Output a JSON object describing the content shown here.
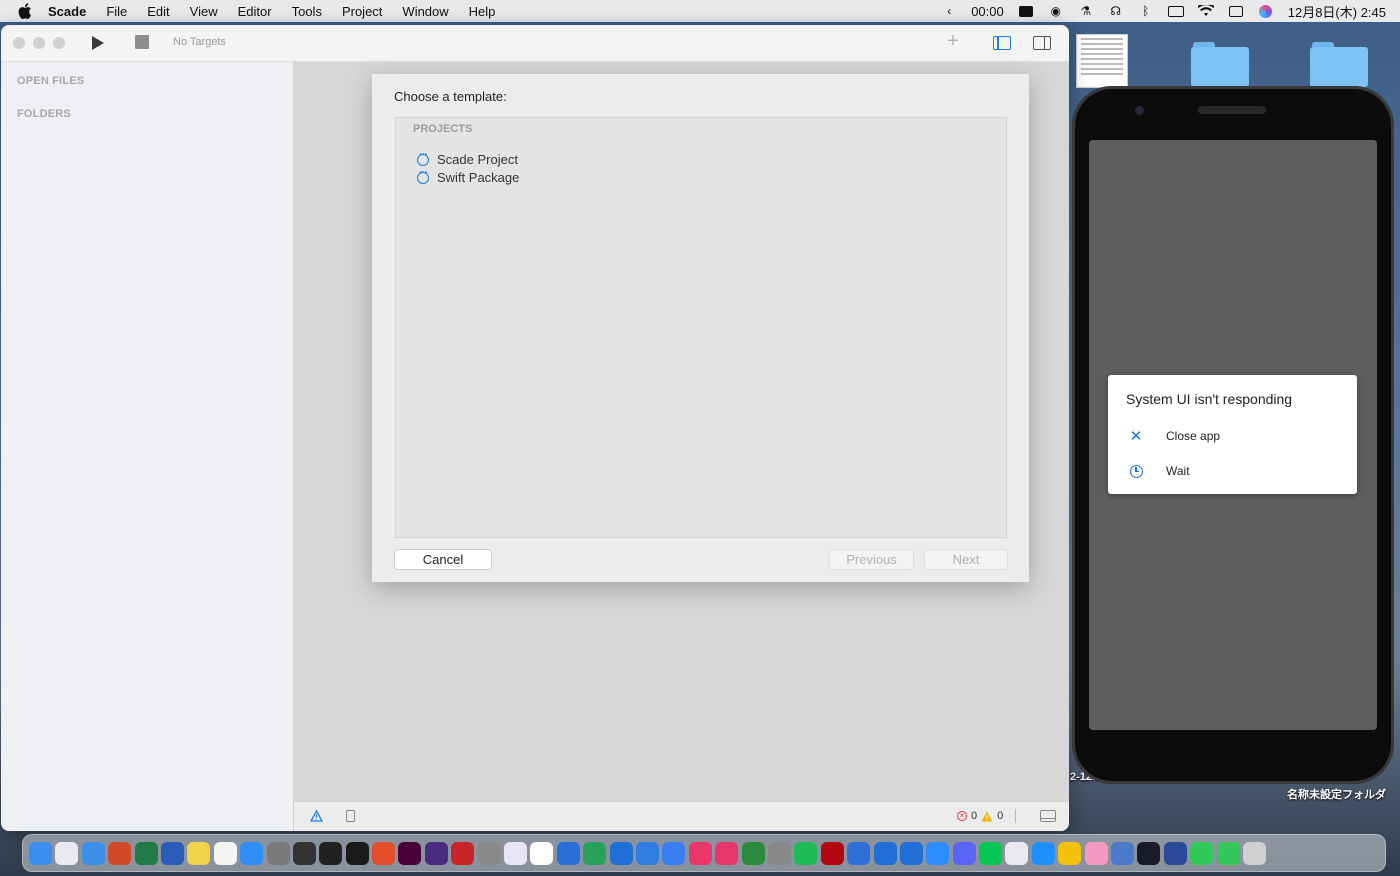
{
  "menubar": {
    "app_name": "Scade",
    "items": [
      "File",
      "Edit",
      "View",
      "Editor",
      "Tools",
      "Project",
      "Window",
      "Help"
    ],
    "time_counter": "00:00",
    "datetime": "12月8日(木) 2:45"
  },
  "desktop": {
    "folder_label": "名称未設定フォルダ",
    "partial_label": "2-12..."
  },
  "window": {
    "targets_label": "No Targets",
    "sidebar": {
      "open_files": "OPEN FILES",
      "folders": "FOLDERS"
    },
    "status": {
      "errors": "0",
      "warnings": "0"
    }
  },
  "dialog": {
    "title": "Choose a template:",
    "section": "PROJECTS",
    "templates": [
      {
        "label": "Scade Project"
      },
      {
        "label": "Swift Package"
      }
    ],
    "cancel": "Cancel",
    "previous": "Previous",
    "next": "Next"
  },
  "phone": {
    "dialog_title": "System UI isn't responding",
    "options": [
      {
        "label": "Close app",
        "icon": "close-icon"
      },
      {
        "label": "Wait",
        "icon": "clock-icon"
      }
    ]
  },
  "dock": {
    "colors": [
      "#3a8ef0",
      "#e9e9ef",
      "#3b8de8",
      "#d04a2a",
      "#1f7a45",
      "#2a5bb8",
      "#f2d24a",
      "#f4f4f4",
      "#2f8df5",
      "#7a7a7a",
      "#333333",
      "#222222",
      "#1a1a1a",
      "#e24e2a",
      "#470137",
      "#4b2a82",
      "#c8242a",
      "#8a8a8a",
      "#e6e6f4",
      "#ffffff",
      "#2a6fd8",
      "#2aa15a",
      "#1e6fd6",
      "#2d7ee0",
      "#3b7ef0",
      "#e8356a",
      "#e8356a",
      "#2b8a3e",
      "#888888",
      "#1db954",
      "#b20710",
      "#2f6fd8",
      "#1f6fd6",
      "#1f6fd6",
      "#2d8cff",
      "#5865f2",
      "#06c755",
      "#e9e9ef",
      "#1e90ff",
      "#f4c20d",
      "#f49ac2",
      "#4a7ac8",
      "#1a1a2a",
      "#2c4a9a",
      "#34c759",
      "#34c759",
      "#d0d0d0"
    ]
  }
}
